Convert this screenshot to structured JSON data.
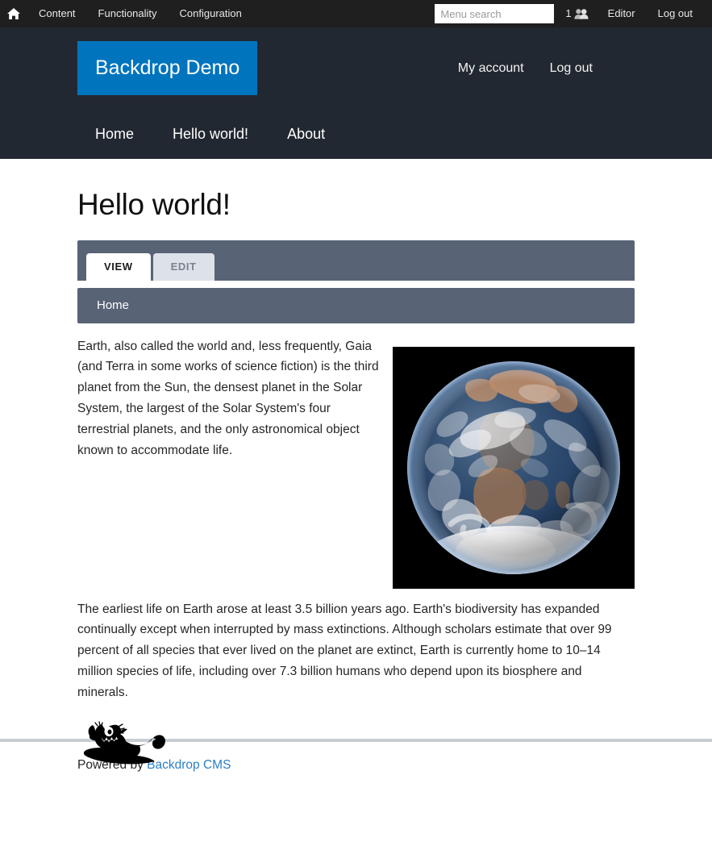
{
  "admin_toolbar": {
    "home_icon": "home-icon",
    "links": [
      "Content",
      "Functionality",
      "Configuration"
    ],
    "search_placeholder": "Menu search",
    "search_value": "",
    "user_count": "1",
    "people_icon": "people-icon",
    "account_label": "Editor",
    "logout_label": "Log out"
  },
  "header": {
    "site_name": "Backdrop Demo",
    "site_name_bg": "#0074bd",
    "secondary_menu": [
      "My account",
      "Log out"
    ],
    "main_menu": [
      "Home",
      "Hello world!",
      "About"
    ],
    "bg": "#222831"
  },
  "page": {
    "title": "Hello world!",
    "tabs": [
      {
        "label": "VIEW",
        "active": true
      },
      {
        "label": "EDIT",
        "active": false
      }
    ],
    "tabs_bg": "#596376",
    "breadcrumb": [
      "Home"
    ],
    "image_alt": "Earth seen from space, the Blue Marble",
    "paragraphs": [
      "Earth, also called the world and, less frequently, Gaia (and Terra in some works of science fiction) is the third planet from the Sun, the densest planet in the Solar System, the largest of the Solar System's four terrestrial planets, and the only astronomical object known to accommodate life.",
      "The earliest life on Earth arose at least 3.5 billion years ago. Earth's biodiversity has expanded continually except when interrupted by mass extinctions. Although scholars estimate that over 99 percent of all species that ever lived on the planet are extinct, Earth is currently home to 10–14 million species of life, including over 7.3 billion humans who depend upon its biosphere and minerals."
    ]
  },
  "footer": {
    "mascot_icon": "backdrop-mascot-icon",
    "powered_prefix": "Powered by ",
    "powered_link": "Backdrop CMS",
    "link_color": "#2c7fc4"
  }
}
